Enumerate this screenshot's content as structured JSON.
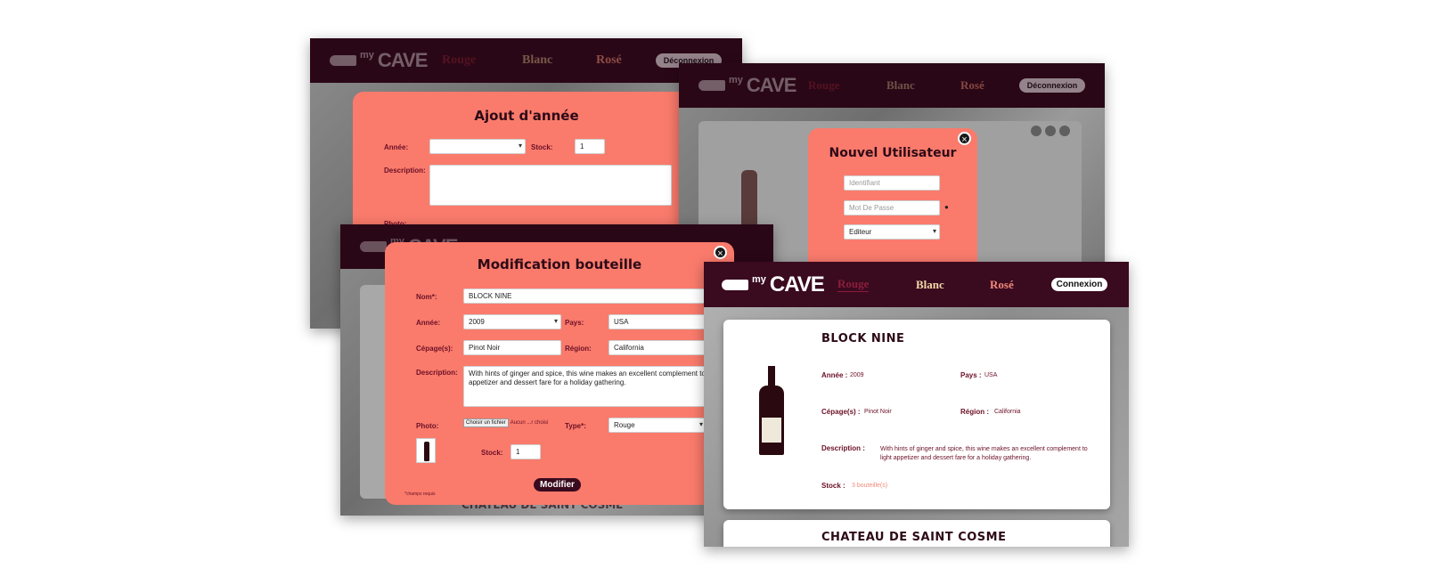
{
  "app": {
    "logo_my": "my",
    "logo_cave": "CAVE"
  },
  "nav": {
    "rouge": "Rouge",
    "blanc": "Blanc",
    "rose": "Rosé",
    "deconnexion": "Déconnexion",
    "connexion": "Connexion"
  },
  "ajout": {
    "title": "Ajout d'année",
    "annee_label": "Année:",
    "annee_value": "",
    "stock_label": "Stock:",
    "stock_value": "1",
    "description_label": "Description:",
    "photo_label": "Photo:"
  },
  "nouvel": {
    "title": "Nouvel Utilisateur",
    "identifiant_placeholder": "Identifiant",
    "motdepasse_placeholder": "Mot De Passe",
    "role_value": "Editeur"
  },
  "modif": {
    "title": "Modification bouteille",
    "nom_label": "Nom*:",
    "nom_value": "BLOCK NINE",
    "annee_label": "Année:",
    "annee_value": "2009",
    "pays_label": "Pays:",
    "pays_value": "USA",
    "cepage_label": "Cépage(s):",
    "cepage_value": "Pinot Noir",
    "region_label": "Région:",
    "region_value": "California",
    "description_label": "Description:",
    "description_value": "With hints of ginger and spice, this wine makes an excellent complement to light appetizer and dessert fare for a holiday gathering.",
    "photo_label": "Photo:",
    "file_button": "Choisir un fichier",
    "file_status": "Aucun ...r choisi",
    "type_label": "Type*:",
    "type_value": "Rouge",
    "stock_label": "Stock:",
    "stock_value": "1",
    "submit": "Modifier",
    "required_note": "*champs requis",
    "behind_title": "CHATEAU DE SAINT COSME"
  },
  "detail": {
    "wine1": {
      "name": "BLOCK NINE",
      "annee_label": "Année :",
      "annee_value": "2009",
      "pays_label": "Pays :",
      "pays_value": "USA",
      "cepage_label": "Cépage(s) :",
      "cepage_value": "Pinot Noir",
      "region_label": "Région :",
      "region_value": "California",
      "description_label": "Description :",
      "description_value": "With hints of ginger and spice, this wine makes an excellent complement to light appetizer and dessert fare for a holiday gathering.",
      "stock_label": "Stock :",
      "stock_value": "3 bouteille(s)"
    },
    "wine2": {
      "name": "CHATEAU DE SAINT COSME"
    }
  },
  "colors": {
    "nav": "#3a0a1f",
    "modal": "#fa7b6c",
    "accent": "#6b0f27",
    "rose_link": "#f08a7a",
    "blanc_link": "#f4d9a8"
  }
}
